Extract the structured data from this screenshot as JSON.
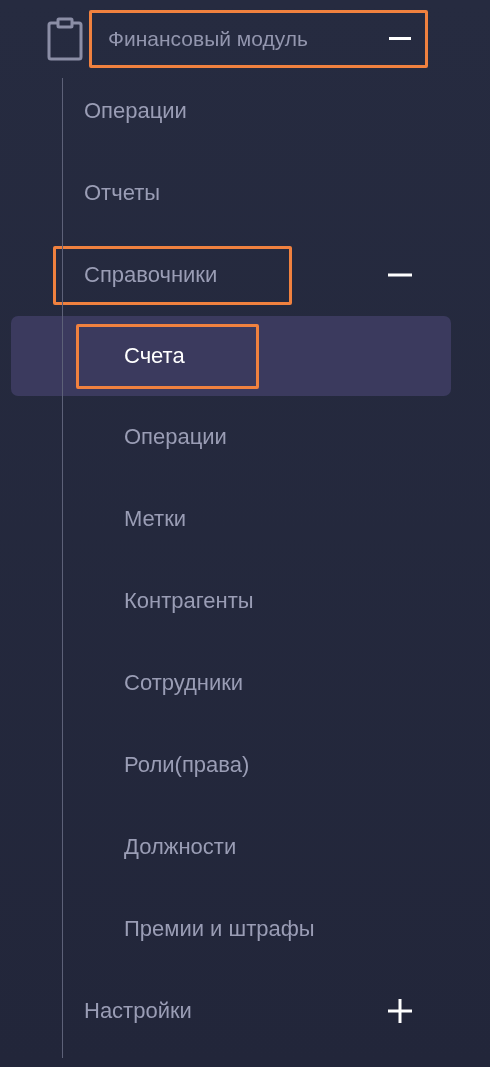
{
  "module": {
    "title": "Финансовый модуль",
    "expanded": true,
    "highlighted": true,
    "items": [
      {
        "label": "Операции",
        "selected": false,
        "highlighted": false
      },
      {
        "label": "Отчеты",
        "selected": false,
        "highlighted": false
      },
      {
        "label": "Справочники",
        "selected": false,
        "highlighted": true,
        "expanded": true,
        "children": [
          {
            "label": "Счета",
            "selected": true,
            "highlighted": true
          },
          {
            "label": "Операции",
            "selected": false,
            "highlighted": false
          },
          {
            "label": "Метки",
            "selected": false,
            "highlighted": false
          },
          {
            "label": "Контрагенты",
            "selected": false,
            "highlighted": false
          },
          {
            "label": "Сотрудники",
            "selected": false,
            "highlighted": false
          },
          {
            "label": "Роли(права)",
            "selected": false,
            "highlighted": false
          },
          {
            "label": "Должности",
            "selected": false,
            "highlighted": false
          },
          {
            "label": "Премии и штрафы",
            "selected": false,
            "highlighted": false
          }
        ]
      },
      {
        "label": "Настройки",
        "selected": false,
        "highlighted": false,
        "expanded": false
      }
    ]
  }
}
